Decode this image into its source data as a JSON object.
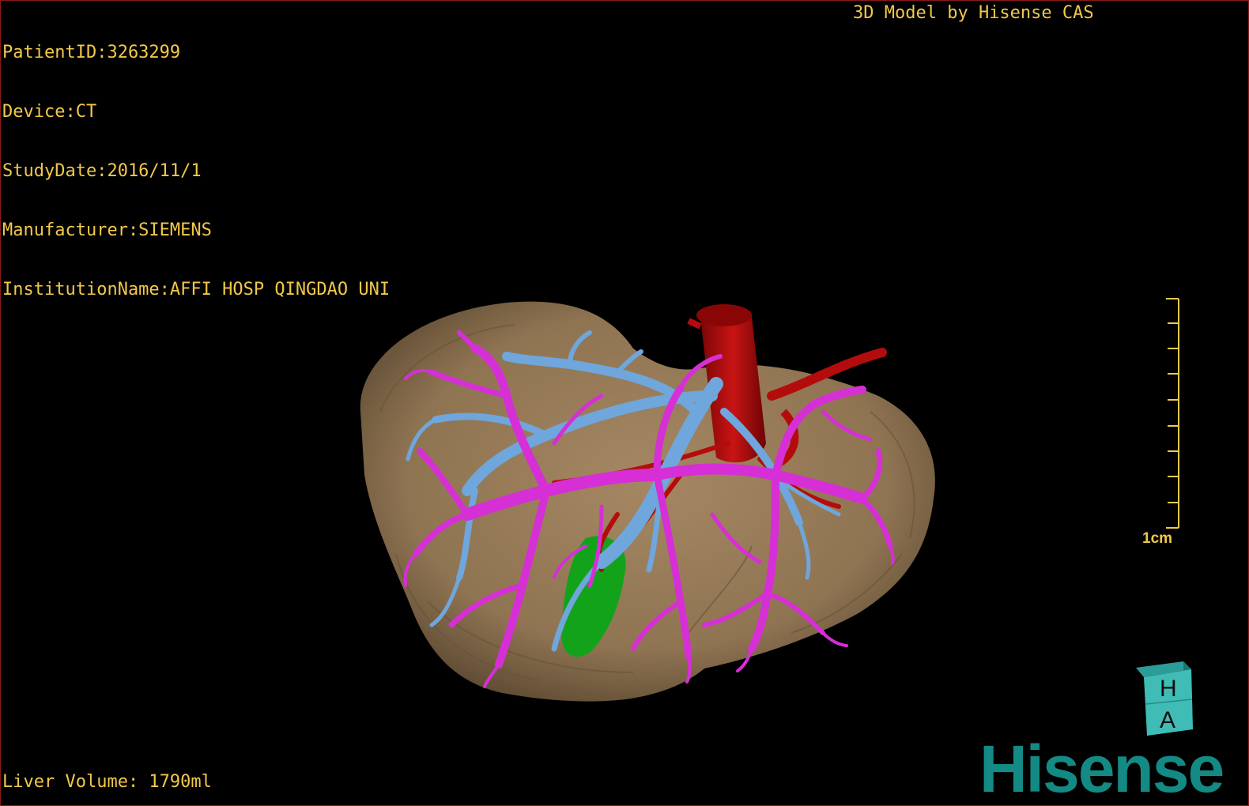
{
  "header": {
    "patient_id": "PatientID:3263299",
    "device": "Device:CT",
    "study_date": "StudyDate:2016/11/1",
    "manufacturer": "Manufacturer:SIEMENS",
    "institution": "InstitutionName:AFFI HOSP QINGDAO UNI",
    "credit": "3D Model by Hisense CAS"
  },
  "footer": {
    "liver_volume": "Liver Volume: 1790ml",
    "brand": "Hisense"
  },
  "scale_bar": {
    "label": "1cm"
  },
  "orientation_cube": {
    "top_letter": "H",
    "bottom_letter": "A"
  },
  "model": {
    "liver_color": "#8f7452",
    "portal_vein_color": "#d62fd6",
    "hepatic_vein_color": "#6fa6dc",
    "artery_color": "#b40c0c",
    "gallbladder_color": "#13a31b"
  },
  "colors": {
    "text": "#f2c84b",
    "brand": "#138a83",
    "background": "#000000"
  }
}
